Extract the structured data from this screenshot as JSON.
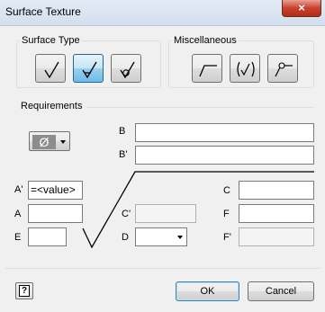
{
  "window": {
    "title": "Surface Texture",
    "close_glyph": "×"
  },
  "surface_type": {
    "label": "Surface Type",
    "buttons": [
      {
        "name": "basic-surface-texture-icon",
        "pressed": false
      },
      {
        "name": "material-removal-required-icon",
        "pressed": true
      },
      {
        "name": "material-removal-prohibited-icon",
        "pressed": false
      }
    ]
  },
  "miscellaneous": {
    "label": "Miscellaneous",
    "buttons": [
      {
        "name": "long-leg-icon"
      },
      {
        "name": "all-around-parenthesis-icon"
      },
      {
        "name": "all-around-icon"
      }
    ]
  },
  "requirements": {
    "label": "Requirements",
    "lay_symbol": "Ø"
  },
  "fields": {
    "b_label": "B",
    "b_value": "",
    "b_prime_label": "B'",
    "b_prime_value": "",
    "a_prime_label": "A'",
    "a_prime_value": "=<value>",
    "a_label": "A",
    "a_value": "",
    "e_label": "E",
    "e_value": "",
    "c_prime_label": "C'",
    "c_prime_value": "",
    "d_label": "D",
    "d_value": "",
    "c_label": "C",
    "c_value": "",
    "f_label": "F",
    "f_value": "",
    "f_prime_label": "F'",
    "f_prime_value": ""
  },
  "footer": {
    "help_glyph": "?",
    "ok_label": "OK",
    "cancel_label": "Cancel"
  }
}
